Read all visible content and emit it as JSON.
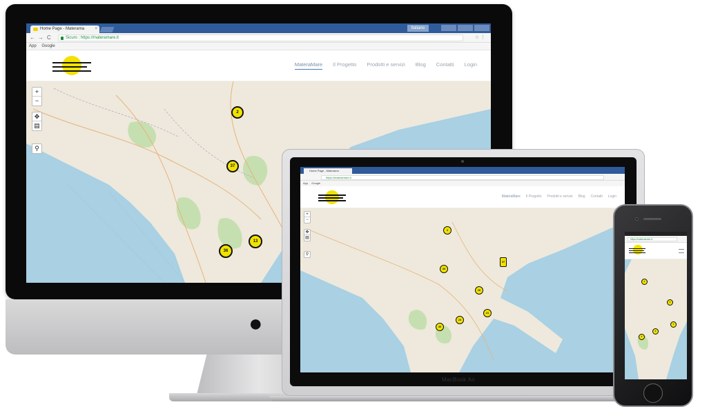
{
  "browser": {
    "tab_title": "Home Page - Materama",
    "tab_close": "×",
    "user_chip": "Italiano",
    "back_glyph": "←",
    "forward_glyph": "→",
    "reload_glyph": "C",
    "secure_label": "Sicuro",
    "url": "https://materamare.it",
    "bookmarks": [
      "App",
      "Google"
    ]
  },
  "site": {
    "menu": [
      "MateraMare",
      "Il Progetto",
      "Prodotti e servizi",
      "Blog",
      "Contatti",
      "Login"
    ],
    "active_menu": "MateraMare"
  },
  "map": {
    "controls": {
      "zoom_in": "+",
      "zoom_out": "−",
      "locate": "✥",
      "layers": "▤",
      "search": "⚲"
    },
    "imac_markers": [
      "2",
      "37",
      "13",
      "36"
    ],
    "macbook_markers": [
      "2",
      "33",
      "37",
      "26",
      "21",
      "23",
      "30"
    ],
    "iphone_markers": [
      "2",
      "3",
      "7",
      "3",
      "2"
    ],
    "colors": {
      "sea": "#a9d0e3",
      "land": "#eee9dc",
      "park": "#c6dfb0",
      "marker": "#f1e200"
    }
  },
  "device_labels": {
    "laptop": "MacBook Air"
  }
}
